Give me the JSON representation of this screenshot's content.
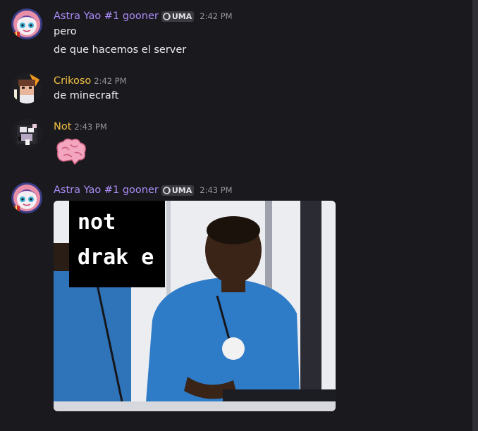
{
  "messages": [
    {
      "username": "Astra Yao #1 gooner",
      "username_color": "#a98bf5",
      "tag": "UMA",
      "time": "2:42 PM",
      "lines": [
        "pero",
        "de que hacemos el server"
      ]
    },
    {
      "username": "Crikoso",
      "username_color": "#f0c043",
      "time": "2:42 PM",
      "lines": [
        "de minecraft"
      ]
    },
    {
      "username": "Not",
      "username_color": "#f0c043",
      "time": "2:43 PM",
      "emoji": "brain-emoji"
    },
    {
      "username": "Astra Yao #1 gooner",
      "username_color": "#a98bf5",
      "tag": "UMA",
      "time": "2:43 PM",
      "attachment": {
        "caption_lines": [
          "not",
          "drak e"
        ]
      }
    }
  ],
  "colors": {
    "background": "#1a1a1e",
    "text": "#ededf0",
    "timestamp": "#94959c"
  }
}
